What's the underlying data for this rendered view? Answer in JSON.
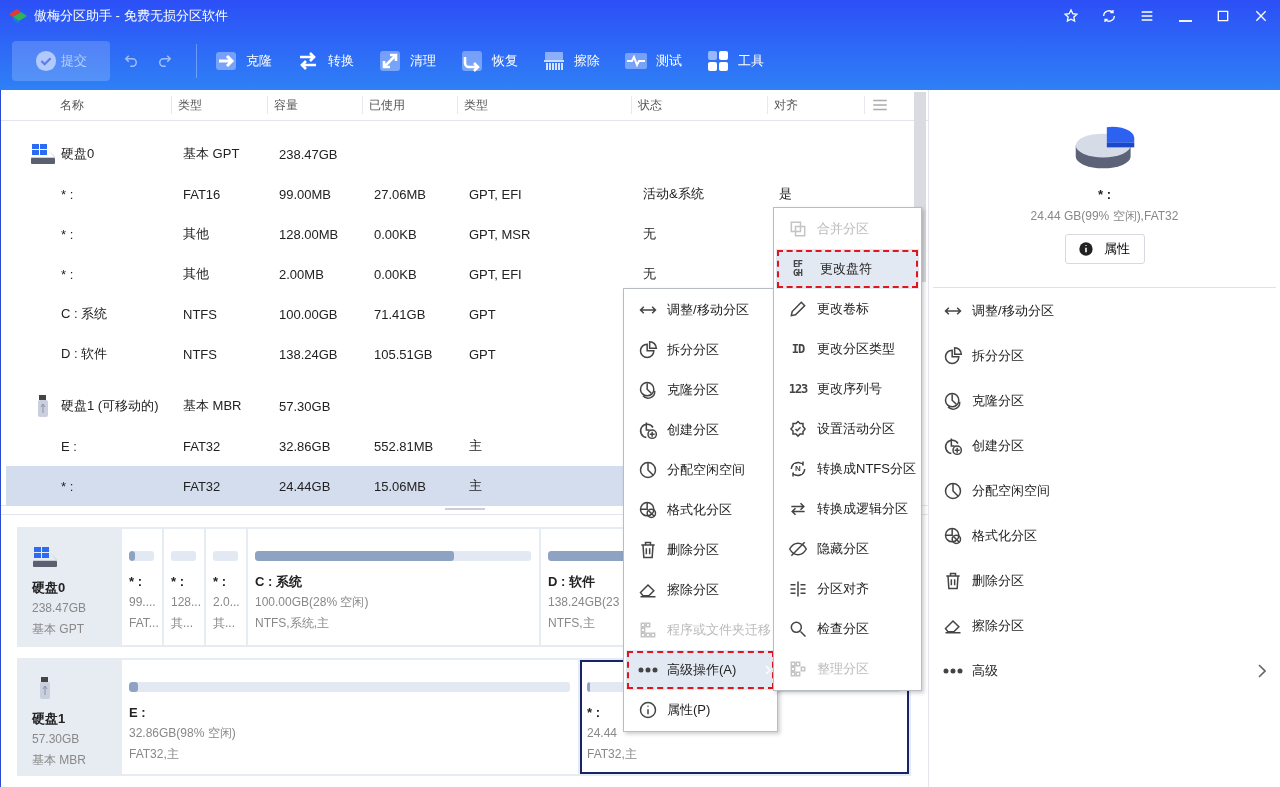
{
  "window": {
    "title": "傲梅分区助手 - 免费无损分区软件"
  },
  "toolbar": {
    "submit": {
      "label": "提交",
      "disabled": true
    },
    "tools": [
      {
        "label": "克隆"
      },
      {
        "label": "转换"
      },
      {
        "label": "清理"
      },
      {
        "label": "恢复"
      },
      {
        "label": "擦除"
      },
      {
        "label": "测试"
      },
      {
        "label": "工具"
      }
    ]
  },
  "table": {
    "columns": [
      "名称",
      "类型",
      "容量",
      "已使用",
      "类型",
      "状态",
      "对齐"
    ],
    "rows": [
      {
        "kind": "disk",
        "name": "硬盘0",
        "type": "基本 GPT",
        "capacity": "238.47GB",
        "selected": false
      },
      {
        "kind": "partition",
        "name": "* :",
        "type": "FAT16",
        "capacity": "99.00MB",
        "used": "27.06MB",
        "ptype": "GPT, EFI",
        "status": "活动&系统",
        "align": "是",
        "selected": false
      },
      {
        "kind": "partition",
        "name": "* :",
        "type": "其他",
        "capacity": "128.00MB",
        "used": "0.00KB",
        "ptype": "GPT, MSR",
        "status": "无",
        "selected": false
      },
      {
        "kind": "partition",
        "name": "* :",
        "type": "其他",
        "capacity": "2.00MB",
        "used": "0.00KB",
        "ptype": "GPT, EFI",
        "status": "无",
        "selected": false
      },
      {
        "kind": "partition",
        "name": "C : 系统",
        "type": "NTFS",
        "capacity": "100.00GB",
        "used": "71.41GB",
        "ptype": "GPT",
        "selected": false
      },
      {
        "kind": "partition",
        "name": "D : 软件",
        "type": "NTFS",
        "capacity": "138.24GB",
        "used": "105.51GB",
        "ptype": "GPT",
        "selected": false
      },
      {
        "kind": "usb",
        "name": "硬盘1 (可移动的)",
        "type": "基本 MBR",
        "capacity": "57.30GB",
        "selected": false
      },
      {
        "kind": "partition",
        "name": "E :",
        "type": "FAT32",
        "capacity": "32.86GB",
        "used": "552.81MB",
        "ptype": "主",
        "selected": false
      },
      {
        "kind": "partition",
        "name": "* :",
        "type": "FAT32",
        "capacity": "24.44GB",
        "used": "15.06MB",
        "ptype": "主",
        "selected": true
      }
    ]
  },
  "disk_map": [
    {
      "kind": "disk",
      "name": "硬盘0",
      "size": "238.47GB",
      "type": "基本 GPT",
      "partitions": [
        {
          "name": "* :",
          "size": "99....",
          "fs": "FAT...",
          "level": 0.25,
          "selected": false
        },
        {
          "name": "* :",
          "size": "128...",
          "fs": "其...",
          "level": 0,
          "selected": false
        },
        {
          "name": "* :",
          "size": "2.0...",
          "fs": "其...",
          "level": 0,
          "selected": false
        },
        {
          "name": "C : 系统",
          "size": "100.00GB(28% 空闲)",
          "fs": "NTFS,系统,主",
          "level": 0.72,
          "selected": false
        },
        {
          "name": "D : 软件",
          "size": "138.24GB(23",
          "fs": "NTFS,主",
          "level": 0.77,
          "selected": false
        }
      ]
    },
    {
      "kind": "usb",
      "name": "硬盘1",
      "size": "57.30GB",
      "type": "基本 MBR",
      "partitions": [
        {
          "name": "E :",
          "size": "32.86GB(98% 空闲)",
          "fs": "FAT32,主",
          "level": 0.02,
          "selected": false
        },
        {
          "name": "* :",
          "size": "24.44",
          "fs": "FAT32,主",
          "level": 0.01,
          "selected": true
        }
      ]
    }
  ],
  "context_menu": {
    "items": [
      {
        "label": "调整/移动分区",
        "kind": "action",
        "disabled": false,
        "selected": false,
        "marked": false
      },
      {
        "label": "拆分分区",
        "kind": "action",
        "disabled": false,
        "selected": false,
        "marked": false
      },
      {
        "label": "克隆分区",
        "kind": "action",
        "disabled": false,
        "selected": false,
        "marked": false
      },
      {
        "label": "创建分区",
        "kind": "action",
        "disabled": false,
        "selected": false,
        "marked": false
      },
      {
        "label": "分配空闲空间",
        "kind": "action",
        "disabled": false,
        "selected": false,
        "marked": false
      },
      {
        "label": "格式化分区",
        "kind": "action",
        "disabled": false,
        "selected": false,
        "marked": false
      },
      {
        "label": "删除分区",
        "kind": "action",
        "disabled": false,
        "selected": false,
        "marked": false
      },
      {
        "label": "擦除分区",
        "kind": "action",
        "disabled": false,
        "selected": false,
        "marked": false
      },
      {
        "label": "程序或文件夹迁移",
        "kind": "action",
        "disabled": true,
        "selected": false,
        "marked": false
      },
      {
        "label": "高级操作(A)",
        "kind": "submenu",
        "disabled": false,
        "selected": true,
        "marked": true
      },
      {
        "label": "属性(P)",
        "kind": "action",
        "disabled": false,
        "selected": false,
        "marked": false
      }
    ],
    "submenu": [
      {
        "label": "合并分区",
        "disabled": true,
        "selected": false,
        "marked": false
      },
      {
        "label": "更改盘符",
        "glyph": "EFGH",
        "disabled": false,
        "selected": true,
        "marked": true
      },
      {
        "label": "更改卷标",
        "disabled": false,
        "selected": false,
        "marked": false
      },
      {
        "label": "更改分区类型",
        "glyph": "ID",
        "disabled": false,
        "selected": false,
        "marked": false
      },
      {
        "label": "更改序列号",
        "glyph": "123",
        "disabled": false,
        "selected": false,
        "marked": false
      },
      {
        "label": "设置活动分区",
        "disabled": false,
        "selected": false,
        "marked": false
      },
      {
        "label": "转换成NTFS分区",
        "glyph": "N",
        "disabled": false,
        "selected": false,
        "marked": false
      },
      {
        "label": "转换成逻辑分区",
        "disabled": false,
        "selected": false,
        "marked": false
      },
      {
        "label": "隐藏分区",
        "disabled": false,
        "selected": false,
        "marked": false
      },
      {
        "label": "分区对齐",
        "disabled": false,
        "selected": false,
        "marked": false
      },
      {
        "label": "检查分区",
        "disabled": false,
        "selected": false,
        "marked": false
      },
      {
        "label": "整理分区",
        "disabled": true,
        "selected": false,
        "marked": false
      }
    ]
  },
  "details": {
    "name": "* :",
    "info": "24.44 GB(99% 空闲),FAT32",
    "button": "属性",
    "actions": [
      {
        "label": "调整/移动分区",
        "kind": "action"
      },
      {
        "label": "拆分分区",
        "kind": "action"
      },
      {
        "label": "克隆分区",
        "kind": "action"
      },
      {
        "label": "创建分区",
        "kind": "action"
      },
      {
        "label": "分配空闲空间",
        "kind": "action"
      },
      {
        "label": "格式化分区",
        "kind": "action"
      },
      {
        "label": "删除分区",
        "kind": "action"
      },
      {
        "label": "擦除分区",
        "kind": "action"
      },
      {
        "label": "高级",
        "kind": "submenu"
      }
    ]
  }
}
